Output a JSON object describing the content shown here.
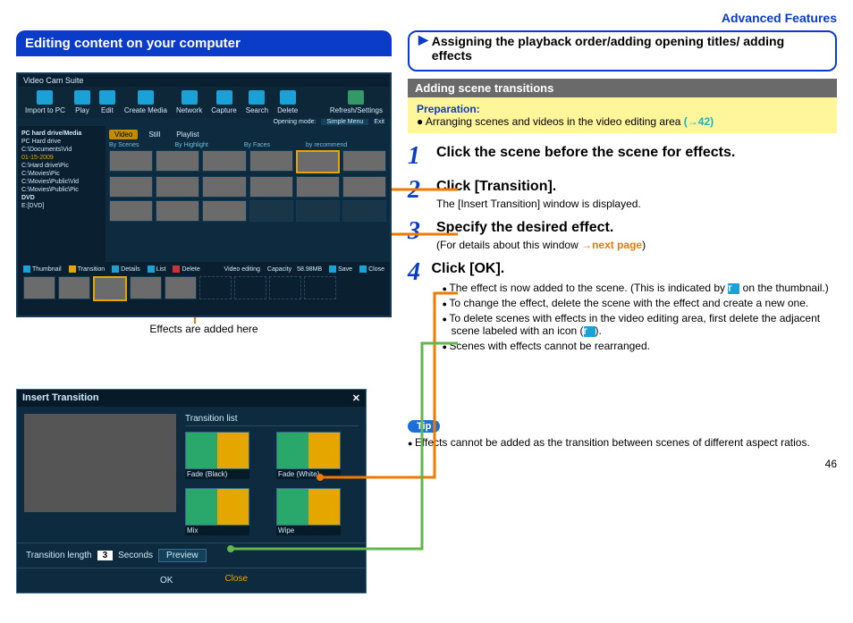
{
  "header": {
    "advanced": "Advanced Features"
  },
  "left": {
    "title": "Editing content on your computer",
    "app": {
      "name": "Video Cam Suite",
      "toolbar": [
        "Import to PC",
        "Play",
        "Edit",
        "Create Media",
        "Network",
        "Capture",
        "Search",
        "Delete"
      ],
      "toolbar_right": "Refresh/Settings",
      "menumode": "Simple Menu",
      "exit": "Exit",
      "sidebar_title": "PC hard drive/Media",
      "sidebar": [
        "PC Hard drive",
        "C:\\Documents\\Vid",
        "01-15-2009",
        "—",
        "C:\\Hard drive\\Pic",
        "C:\\Movies\\Pic",
        "C:\\Movies\\Public\\Vid",
        "C:\\Movies\\Public\\Pic",
        "DVD",
        "E:[DVD]"
      ],
      "tabs": [
        "Video",
        "Still",
        "Playlist"
      ],
      "thumb_labels": [
        "By Scenes",
        "By Highlight",
        "By Faces",
        "by recommend"
      ],
      "timeline_btns": [
        "Thumbnail",
        "Transition",
        "Details",
        "List",
        "Delete"
      ],
      "timeline_right": [
        "Video editing",
        "Capacity",
        "58.98MB",
        "Save",
        "Close"
      ]
    },
    "caption": "Effects are added here",
    "dialog": {
      "title": "Insert Transition",
      "list_head": "Transition list",
      "fx": [
        "Fade (Black)",
        "Fade (White)",
        "Mix",
        "Wipe"
      ],
      "length_label": "Transition length",
      "length_val": "3",
      "seconds": "Seconds",
      "preview": "Preview",
      "ok": "OK",
      "close": "Close"
    }
  },
  "right": {
    "chapter": "Assigning the playback order/adding opening titles/ adding effects",
    "gray": "Adding scene transitions",
    "prep_title": "Preparation:",
    "prep_text": "Arranging scenes and videos in the video editing area ",
    "prep_link": "(→42)",
    "steps": {
      "s1": {
        "n": "1",
        "title": "Click the scene before the scene for effects."
      },
      "s2": {
        "n": "2",
        "title": "Click [Transition].",
        "sub": "The [Insert Transition] window is displayed."
      },
      "s3": {
        "n": "3",
        "title": "Specify the desired effect.",
        "sub1": "(For details about this window ",
        "sub_link": "→next page",
        "sub2": ")"
      },
      "s4": {
        "n": "4",
        "title": "Click [OK].",
        "b1a": "The effect is now added to the scene. (This is indicated by ",
        "b1b": " on the thumbnail.)",
        "b2": "To change the effect, delete the scene with the effect and create a new one.",
        "b3a": "To delete scenes with effects in the video editing area, first delete the adjacent scene labeled with an icon (",
        "b3b": ").",
        "b4": "Scenes with effects cannot be rearranged."
      }
    },
    "tip": "Tip",
    "tip_text": "Effects cannot be added as the transition between scenes of different aspect ratios."
  },
  "page": "46"
}
